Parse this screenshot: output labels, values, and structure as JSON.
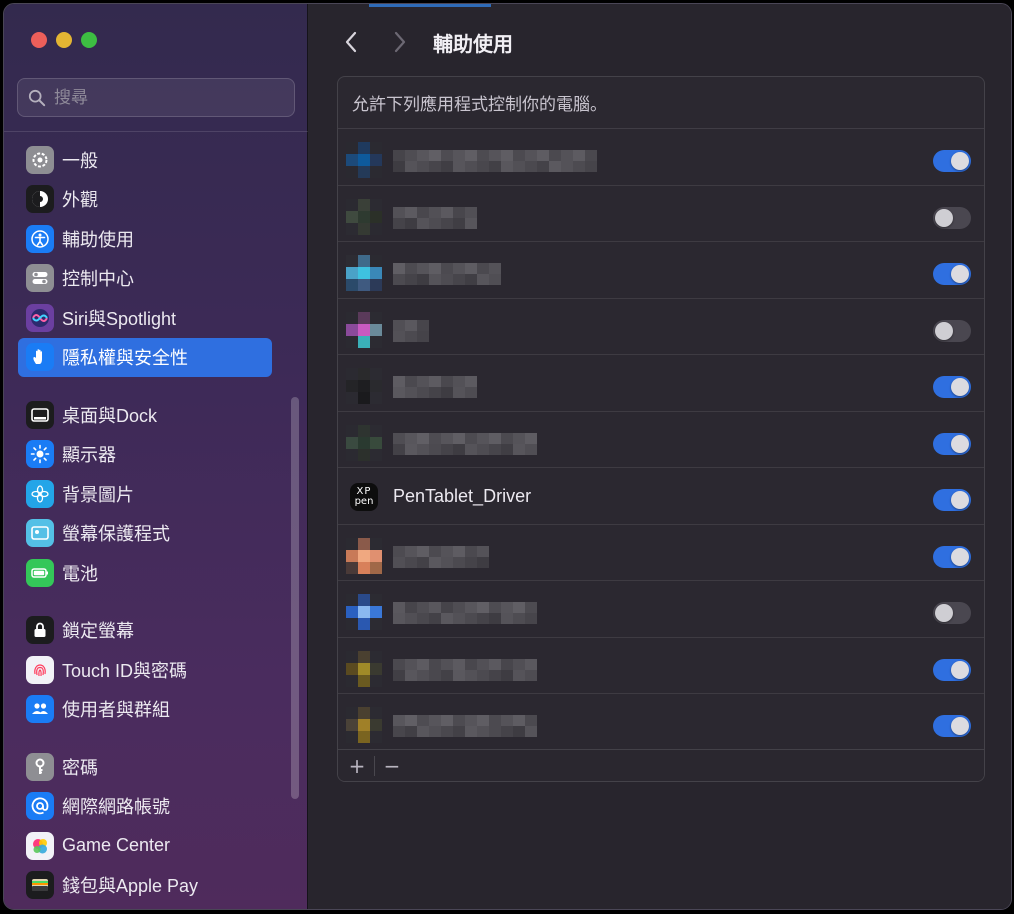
{
  "window": {
    "title": "輔助使用"
  },
  "sidebar": {
    "search_placeholder": "搜尋",
    "items": [
      {
        "label": "一般",
        "icon": "gear-icon",
        "color": "#8e8e93"
      },
      {
        "label": "外觀",
        "icon": "appearance-icon",
        "color": "#1c1c1e"
      },
      {
        "label": "輔助使用",
        "icon": "accessibility-icon",
        "color": "#1a7cf5"
      },
      {
        "label": "控制中心",
        "icon": "control-center-icon",
        "color": "#8e8e93"
      },
      {
        "label": "Siri與Spotlight",
        "icon": "siri-icon",
        "color": "#6b3fa0"
      },
      {
        "label": "隱私權與安全性",
        "icon": "hand-icon",
        "color": "#1a7cf5",
        "selected": true
      },
      {
        "label": "桌面與Dock",
        "icon": "dock-icon",
        "color": "#1c1c1e"
      },
      {
        "label": "顯示器",
        "icon": "display-icon",
        "color": "#1a7cf5"
      },
      {
        "label": "背景圖片",
        "icon": "wallpaper-icon",
        "color": "#23a5e8"
      },
      {
        "label": "螢幕保護程式",
        "icon": "screensaver-icon",
        "color": "#54c0e6"
      },
      {
        "label": "電池",
        "icon": "battery-icon",
        "color": "#34c759"
      },
      {
        "label": "鎖定螢幕",
        "icon": "lock-icon",
        "color": "#1c1c1e"
      },
      {
        "label": "Touch ID與密碼",
        "icon": "fingerprint-icon",
        "color": "#f2f2f7"
      },
      {
        "label": "使用者與群組",
        "icon": "users-icon",
        "color": "#1a7cf5"
      },
      {
        "label": "密碼",
        "icon": "key-icon",
        "color": "#8e8e93"
      },
      {
        "label": "網際網路帳號",
        "icon": "at-icon",
        "color": "#1a7cf5"
      },
      {
        "label": "Game Center",
        "icon": "game-center-icon",
        "color": "#f2f2f7"
      },
      {
        "label": "錢包與Apple Pay",
        "icon": "wallet-icon",
        "color": "#1c1c1e"
      }
    ]
  },
  "main": {
    "title": "輔助使用",
    "panel_header": "允許下列應用程式控制你的電腦。",
    "apps": [
      {
        "name": "",
        "redacted": true,
        "enabled": true,
        "icon": "redacted-app-icon"
      },
      {
        "name": "",
        "redacted": true,
        "enabled": false,
        "icon": "redacted-app-icon"
      },
      {
        "name": "",
        "redacted": true,
        "enabled": true,
        "icon": "redacted-app-icon"
      },
      {
        "name": "",
        "redacted": true,
        "enabled": false,
        "icon": "redacted-app-icon"
      },
      {
        "name": "",
        "redacted": true,
        "enabled": true,
        "icon": "redacted-app-icon"
      },
      {
        "name": "",
        "redacted": true,
        "enabled": true,
        "icon": "redacted-app-icon"
      },
      {
        "name": "PenTablet_Driver",
        "redacted": false,
        "enabled": true,
        "icon": "xp-pen-icon",
        "icon_text_1": "XP",
        "icon_text_2": "pen"
      },
      {
        "name": "",
        "redacted": true,
        "enabled": true,
        "icon": "redacted-app-icon"
      },
      {
        "name": "",
        "redacted": true,
        "enabled": false,
        "icon": "redacted-app-icon"
      },
      {
        "name": "",
        "redacted": true,
        "enabled": true,
        "icon": "redacted-app-icon"
      },
      {
        "name": "",
        "redacted": true,
        "enabled": true,
        "icon": "redacted-app-icon"
      }
    ],
    "footer": {
      "add_label": "+",
      "remove_label": "−"
    }
  },
  "colors": {
    "accent": "#2f6fe0",
    "toggle_off": "#4a4750"
  }
}
